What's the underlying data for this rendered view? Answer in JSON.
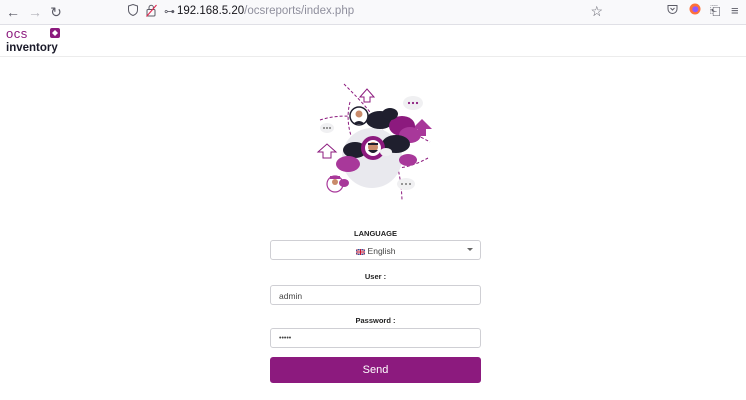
{
  "browser": {
    "url_host": "192.168.5.20",
    "url_path": "/ocsreports/index.php",
    "back_icon": "back-arrow-icon",
    "forward_icon": "forward-arrow-icon",
    "reload_icon": "reload-icon",
    "bookmark_icon": "star-icon"
  },
  "app": {
    "logo_top": "ocs",
    "logo_bottom": "inventory",
    "brand_color": "#8c1a7e"
  },
  "form": {
    "language_label": "LANGUAGE",
    "language_value": "English",
    "user_label": "User :",
    "user_value": "admin",
    "password_label": "Password :",
    "password_value": "•••••",
    "send_label": "Send"
  }
}
